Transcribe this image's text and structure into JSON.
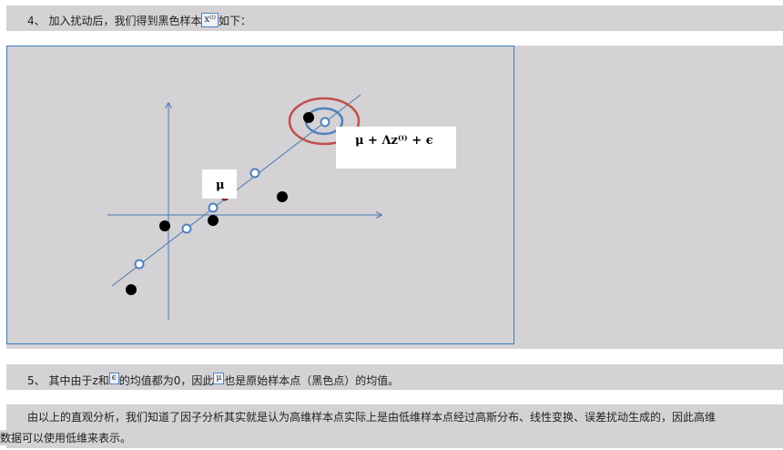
{
  "line1": {
    "prefix": "4、  加入扰动后，我们得到黑色样本",
    "symbol": "x⁽ⁱ⁾",
    "suffix": "如下："
  },
  "figure": {
    "mu_label": "μ",
    "formula_label": "μ + Λz⁽ⁱ⁾ + ϵ"
  },
  "line5": {
    "part1": "5、  其中由于z和",
    "sym_eps": "ϵ",
    "part2": "的均值都为0，因此",
    "sym_mu": "μ",
    "part3": "也是原始样本点（黑色点）的均值。"
  },
  "paragraph": {
    "line_a": "由以上的直观分析，我们知道了因子分析其实就是认为高维样本点实际上是由低维样本点经过高斯分布、线性变换、误差扰动生成的，因此高维",
    "line_b": "数据可以使用低维来表示。"
  }
}
